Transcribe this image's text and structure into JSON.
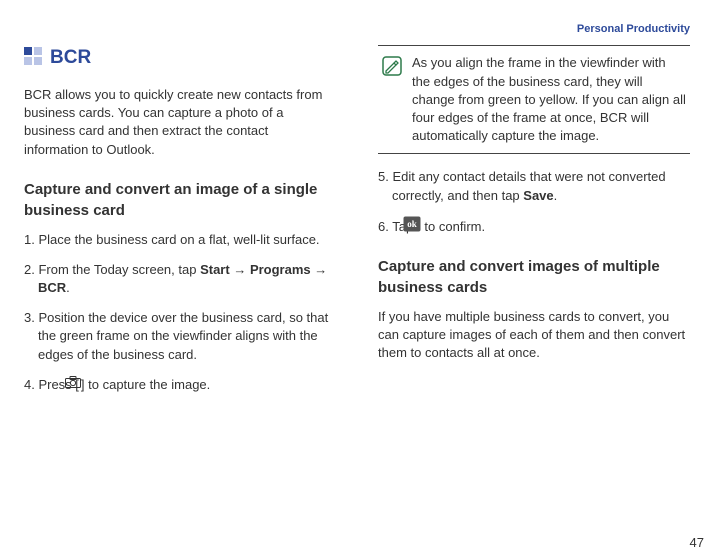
{
  "header": "Personal Productivity",
  "section": {
    "title": "BCR",
    "intro": "BCR allows you to quickly create new contacts from business cards. You can capture a photo of a business card and then extract the contact information to Outlook."
  },
  "subhead1": "Capture and convert an image of a single business card",
  "steps": {
    "s1": "1. Place the business card on a flat, well-lit surface.",
    "s2a": "2. From the Today screen, tap ",
    "s2_start": "Start",
    "s2_arrow1": " → ",
    "s2_programs": "Programs",
    "s2_arrow2": " → ",
    "s2_bcr": "BCR",
    "s2_end": ".",
    "s3": "3. Position the device over the business card, so that the green frame on the viewfinder aligns with the edges of the business card.",
    "s4a": "4. Press [",
    "s4b": "] to capture the image.",
    "s5a": "5. Edit any contact details that were not converted correctly, and then tap ",
    "s5_save": "Save",
    "s5_end": ".",
    "s6a": "6. Tap ",
    "s6b": " to confirm."
  },
  "tip": "As you align the frame in the viewfinder with the edges of the business card, they will change from green to yellow. If you can align all four edges of the frame at once, BCR will automatically capture the image.",
  "subhead2": "Capture and convert images of multiple business cards",
  "multi_intro": "If you have multiple business cards to convert, you can capture images of each of them and then convert them to contacts all at once.",
  "pagenum": "47"
}
